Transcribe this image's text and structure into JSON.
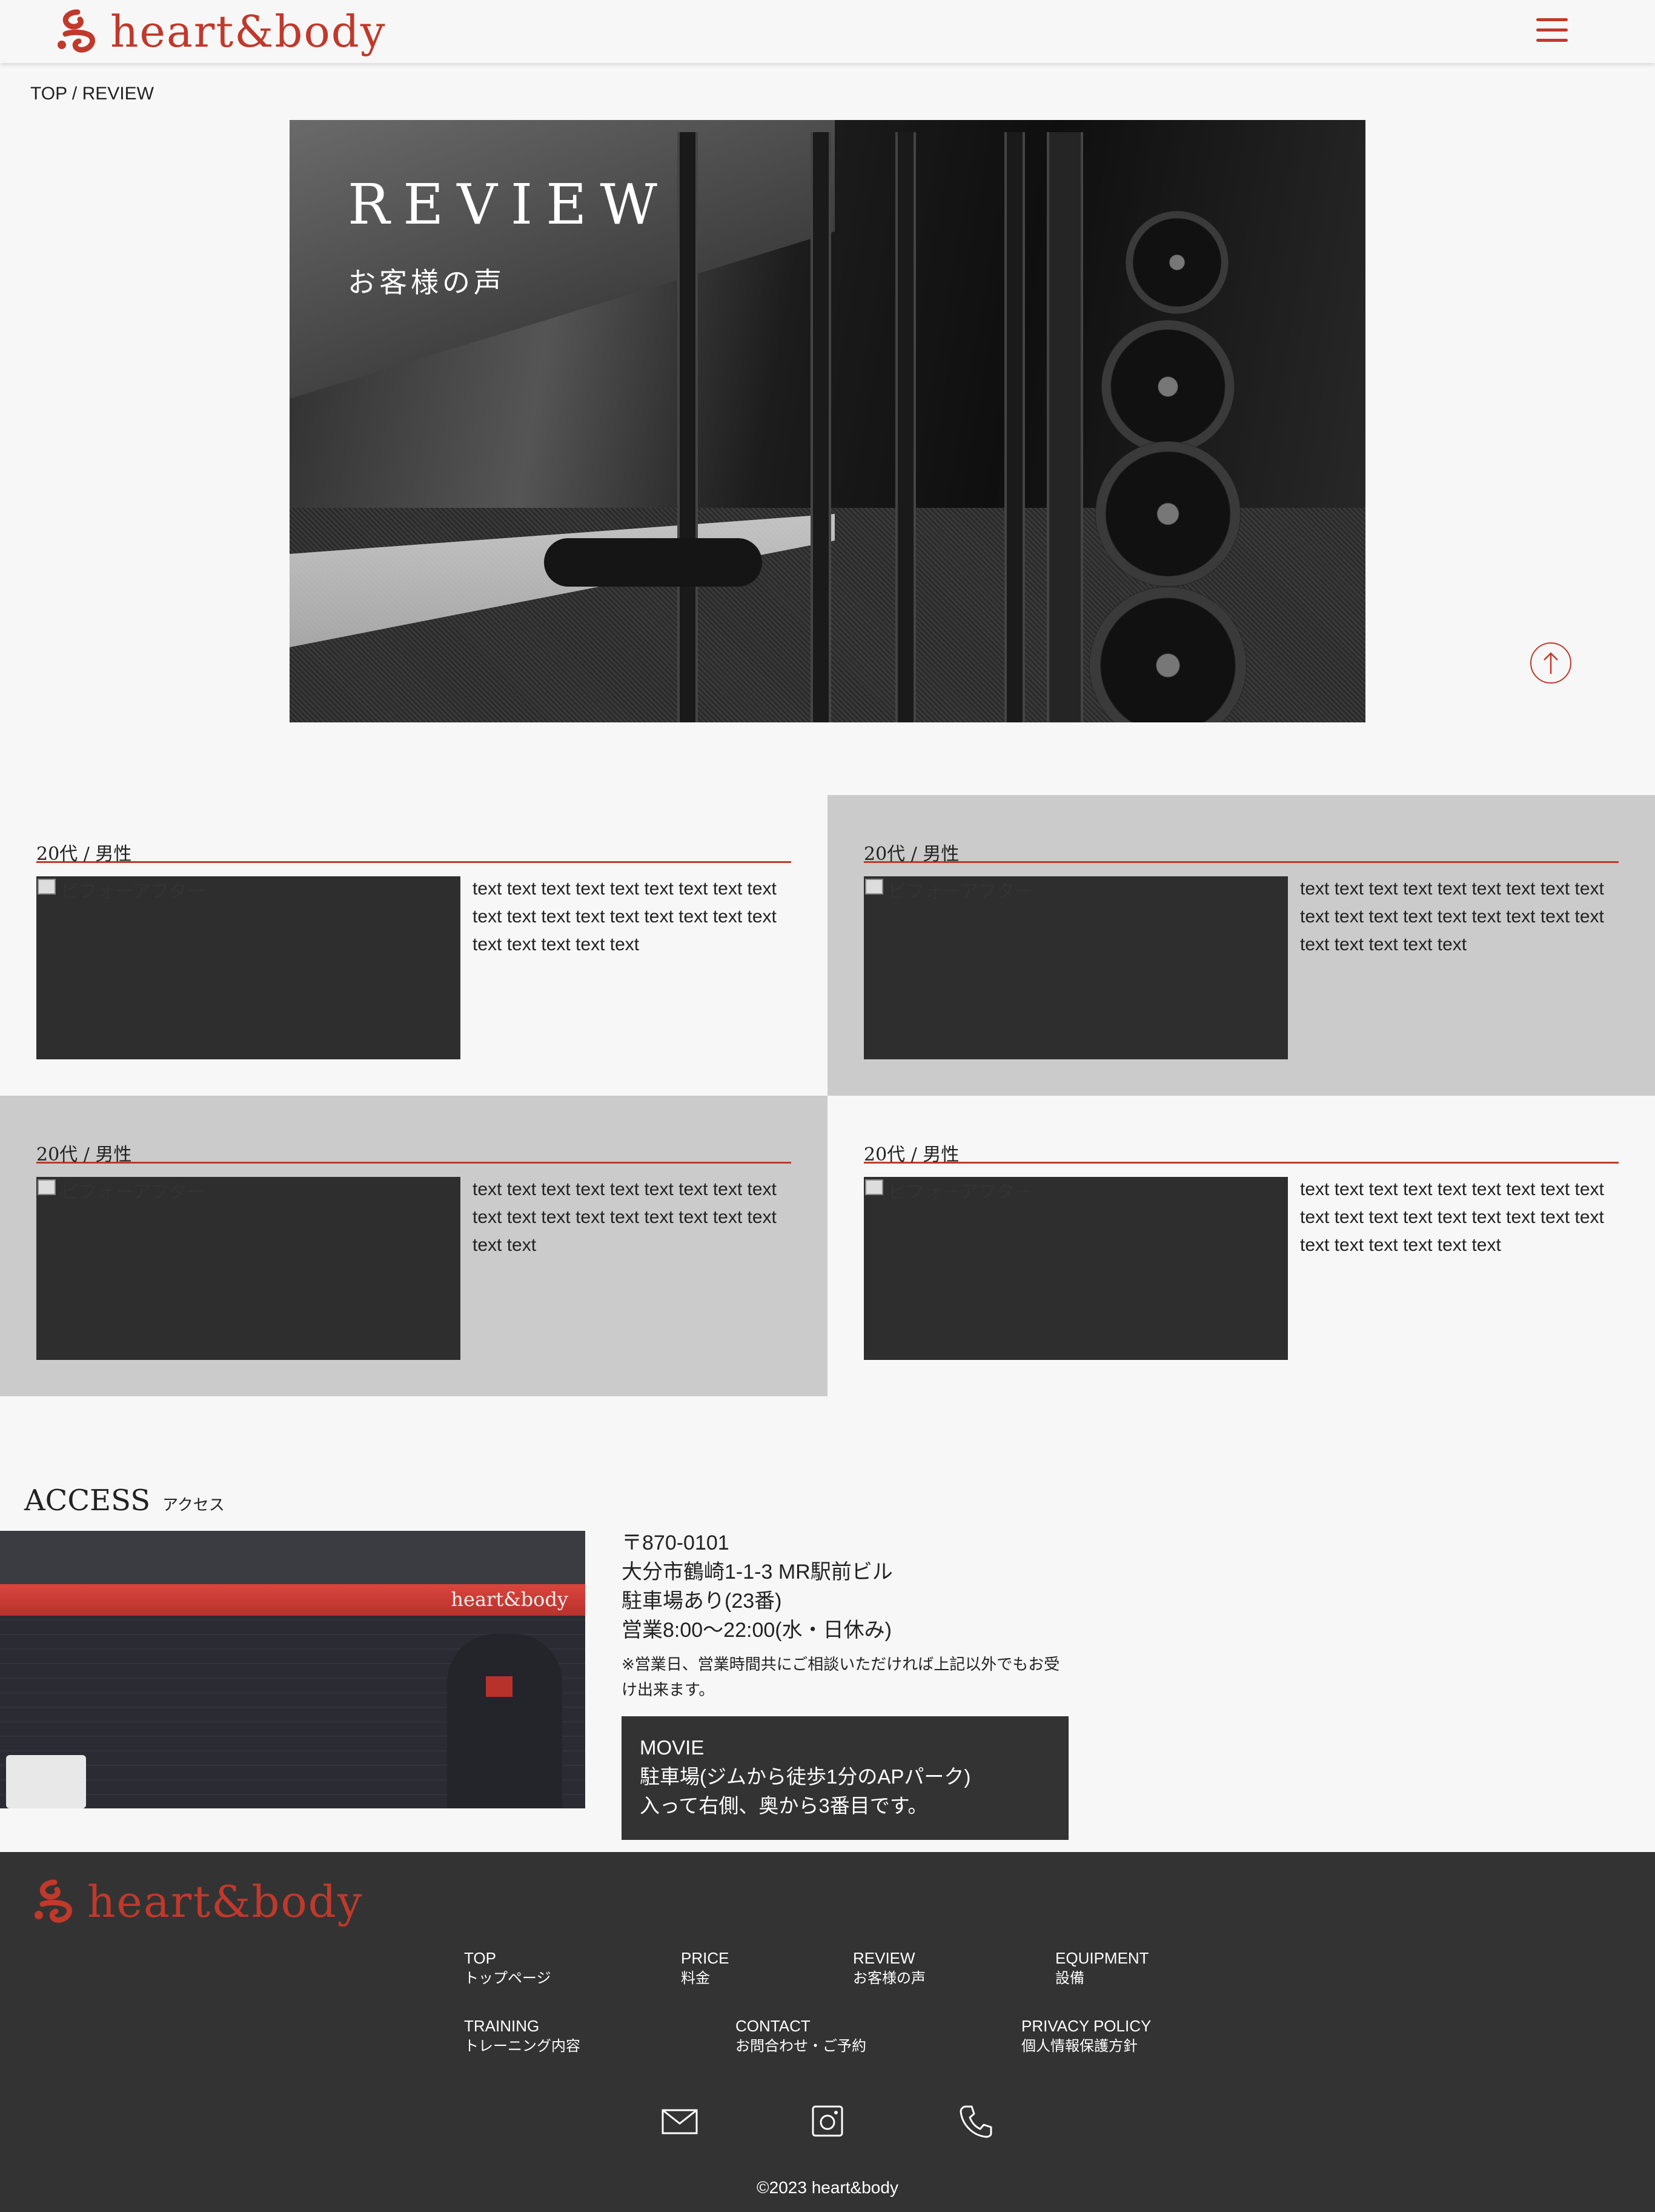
{
  "header": {
    "logo_text": "heart&body",
    "brand_color": "#c0392b",
    "menu_icon": "hamburger-menu-icon"
  },
  "breadcrumb": "TOP / REVIEW",
  "hero": {
    "title": "REVIEW",
    "subtitle": "お客様の声"
  },
  "to_top_icon": "arrow-up-icon",
  "reviews": [
    {
      "meta": "20代 / 男性",
      "image_alt": "ビフォーアフター",
      "text": "text text text text text text text text text text text text text text text text text text text text text text text"
    },
    {
      "meta": "20代 / 男性",
      "image_alt": "ビフォーアフター",
      "text": "text text text text text text text text text text text text text text text text text text text text text text text"
    },
    {
      "meta": "20代 / 男性",
      "image_alt": "ビフォーアフター",
      "text": "text text text text text text text text text text text text text text text text text text text text"
    },
    {
      "meta": "20代 / 男性",
      "image_alt": "ビフォーアフター",
      "text": "text text text text text text text text text text text text text text text text text text text text text text text text"
    }
  ],
  "access": {
    "title_en": "ACCESS",
    "title_ja": "アクセス",
    "store_sign": "heart&body",
    "address_lines": [
      "〒870-0101",
      "大分市鶴崎1-1-3 MR駅前ビル",
      "駐車場あり(23番)",
      "営業8:00～22:00(水・日休み)"
    ],
    "note": "※営業日、営業時間共にご相談いただければ上記以外でもお受け出来ます。",
    "movie": {
      "title": "MOVIE",
      "line1": "駐車場(ジムから徒歩1分のAPパーク)",
      "line2": "入って右側、奥から3番目です。"
    }
  },
  "footer": {
    "logo_text": "heart&body",
    "nav": [
      {
        "en": "TOP",
        "ja": "トップページ"
      },
      {
        "en": "PRICE",
        "ja": "料金"
      },
      {
        "en": "REVIEW",
        "ja": "お客様の声"
      },
      {
        "en": "EQUIPMENT",
        "ja": "設備"
      },
      {
        "en": "TRAINING",
        "ja": "トレーニング内容"
      },
      {
        "en": "CONTACT",
        "ja": "お問合わせ・ご予約"
      },
      {
        "en": "PRIVACY POLICY",
        "ja": "個人情報保護方針"
      }
    ],
    "icons": [
      "mail-icon",
      "instagram-icon",
      "phone-icon"
    ],
    "copyright": "©2023 heart&body",
    "background": "#333333"
  }
}
